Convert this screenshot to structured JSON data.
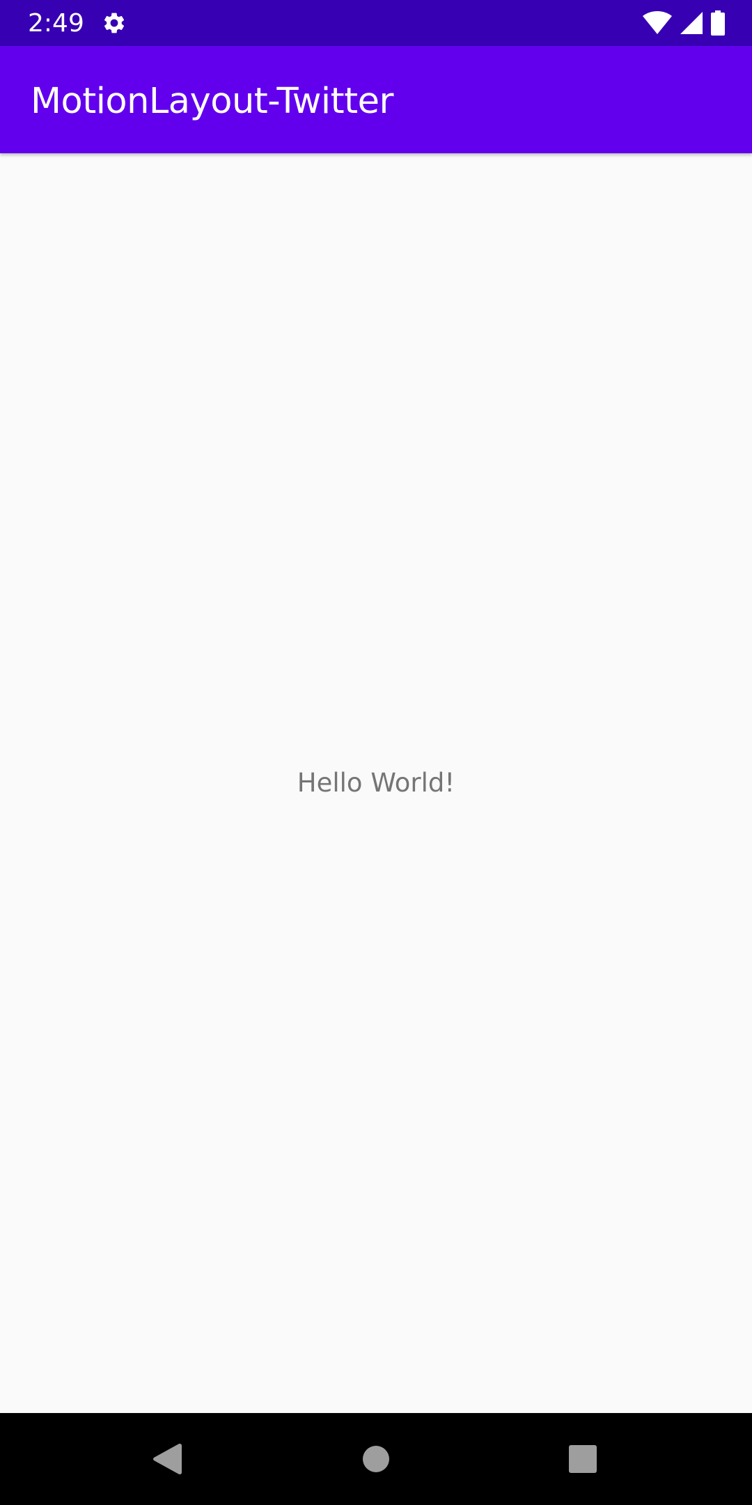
{
  "status_bar": {
    "time": "2:49",
    "icons": [
      "settings-gear-icon",
      "wifi-icon",
      "cell-signal-icon",
      "battery-icon"
    ],
    "background": "#3700b3"
  },
  "app_bar": {
    "title": "MotionLayout-Twitter",
    "background": "#6200ee"
  },
  "content": {
    "message": "Hello World!",
    "text_color": "#757575",
    "background": "#fafafa"
  },
  "nav_bar": {
    "buttons": [
      "back-icon",
      "home-icon",
      "recents-icon"
    ],
    "icon_color": "#9e9e9e",
    "background": "#000000"
  }
}
